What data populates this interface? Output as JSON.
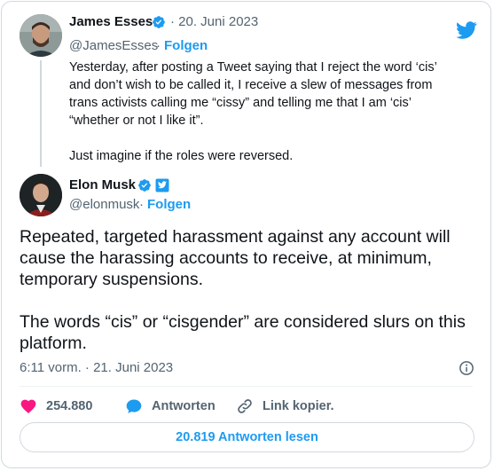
{
  "quoted_tweet": {
    "author_name": "James Esses",
    "date": "· 20. Juni 2023",
    "handle": "@JamesEsses",
    "handle_sep": "·",
    "follow_label": "Folgen",
    "text_p1": "Yesterday, after posting a Tweet saying that I reject the word ‘cis’ and don’t wish to be called it, I receive a slew of messages from trans activists calling me “cissy” and telling me that I am ‘cis’ “whether or not I like it”.",
    "text_p2": "Just imagine if the roles were reversed."
  },
  "main_tweet": {
    "author_name": "Elon Musk",
    "handle": "@elonmusk",
    "handle_sep": "·",
    "follow_label": "Folgen",
    "text_p1": "Repeated, targeted harassment against any account will cause the harassing accounts to receive, at minimum, temporary suspensions.",
    "text_p2": "The words “cis” or “cisgender” are considered slurs on this platform.",
    "timestamp": "6:11 vorm. · 21. Juni 2023"
  },
  "actions": {
    "likes_count": "254.880",
    "reply_label": "Antworten",
    "copy_link_label": "Link kopier."
  },
  "read_replies_label": "20.819 Antworten lesen",
  "colors": {
    "accent": "#1d9bf0",
    "like": "#f91880",
    "text": "#0f1419",
    "muted": "#536471",
    "border": "#cfd9de"
  },
  "icons": {
    "brand": "twitter-bird-icon",
    "verified": "verified-badge-icon",
    "affiliate": "twitter-affiliate-badge-icon",
    "info": "info-icon",
    "like": "heart-icon",
    "reply": "reply-bubble-icon",
    "link": "link-icon"
  }
}
